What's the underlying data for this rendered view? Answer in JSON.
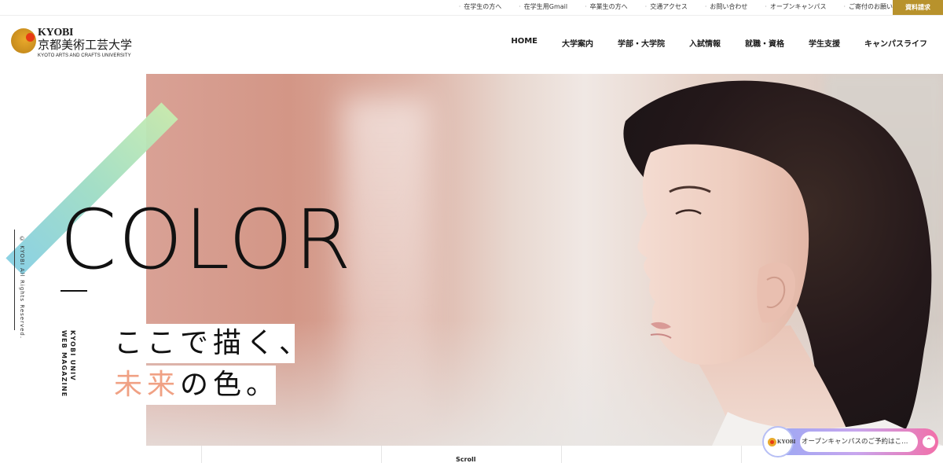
{
  "utility_links": [
    {
      "label": "在学生の方へ"
    },
    {
      "label": "在学生用Gmail"
    },
    {
      "label": "卒業生の方へ"
    },
    {
      "label": "交通アクセス"
    },
    {
      "label": "お問い合わせ"
    },
    {
      "label": "オープンキャンパス"
    },
    {
      "label": "ご寄付のお願い"
    }
  ],
  "cta": {
    "label": "資料請求"
  },
  "logo": {
    "en": "KYOBI",
    "jp": "京都美術工芸大学",
    "sub": "KYOTO ARTS AND CRAFTS UNIVERSITY"
  },
  "nav": [
    {
      "label": "HOME"
    },
    {
      "label": "大学案内"
    },
    {
      "label": "学部・大学院"
    },
    {
      "label": "入試情報"
    },
    {
      "label": "就職・資格"
    },
    {
      "label": "学生支援"
    },
    {
      "label": "キャンパスライフ"
    }
  ],
  "hero": {
    "word": "COLOR",
    "caption_line1": "ここで描く、",
    "caption_line2_accent": "未来",
    "caption_line2_rest": "の色。",
    "copyright": "© KYOBI All Rights Reserved.",
    "magazine_line1": "KYOBI UNIV",
    "magazine_line2": "WEB MAGAZINE"
  },
  "scroll": {
    "label": "Scroll"
  },
  "chat": {
    "avatar_text": "KYOBI",
    "message": "オープンキャンパスのご予約はこ…"
  },
  "colors": {
    "accent_gold": "#b8922c",
    "accent_peach": "#f0a184",
    "logo_red": "#e83a14"
  }
}
